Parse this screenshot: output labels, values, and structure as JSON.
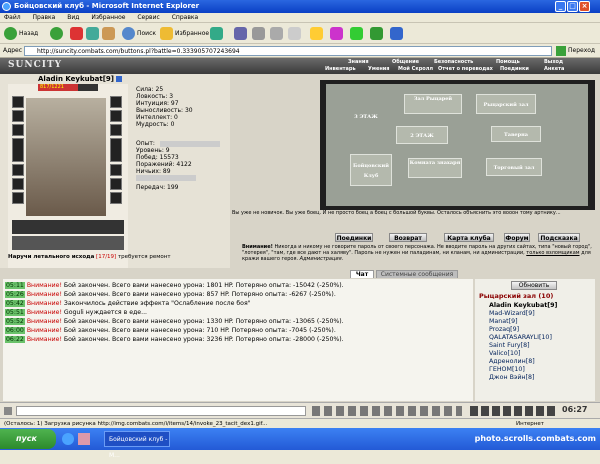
{
  "window": {
    "title": "Бойцовский клуб - Microsoft Internet Explorer"
  },
  "menu": [
    "Файл",
    "Правка",
    "Вид",
    "Избранное",
    "Сервис",
    "Справка"
  ],
  "toolbar": {
    "back": "Назад",
    "search": "Поиск",
    "favorites": "Избранное",
    "links": "Переход",
    "links2": "Ссылки"
  },
  "address": {
    "label": "Адрес",
    "url": "http://suncity.combats.com/buttons.pl?battle=0.333905707243694"
  },
  "game": {
    "logo": "SUNCITY",
    "nav_top": [
      "Знания",
      "Общение",
      "Безопасность",
      "Помощь",
      "Выход"
    ],
    "nav_bottom": [
      "Инвентарь",
      "Умения",
      "Мой Скролл",
      "Отчет о переводах",
      "Поединки",
      "Анкета"
    ],
    "character": {
      "name": "Aladin Keykubat",
      "level_tag": "[9]",
      "hp": "817/1221",
      "stats": [
        "Сила: 25",
        "Ловкость: 3",
        "Интуиция: 97",
        "Выносливость: 30",
        "Интеллект: 0",
        "Мудрость: 0"
      ],
      "experience": [
        "Опыт:",
        "Уровень: 9",
        "Побед: 15573",
        "Поражений: 4122",
        "Ничьих: 89",
        "",
        "Передач: 199"
      ],
      "item_note": "Наручи летального исхода",
      "item_durability": "[17/19]",
      "item_status": "требуется ремонт"
    },
    "map": {
      "floor": "3 ЭТАЖ",
      "rooms": [
        "Зал Рыцарей",
        "Рыцарский зал",
        "2 ЭТАЖ",
        "Таверна",
        "Бойцовский Клуб",
        "Комната знахаря",
        "Торговый зал"
      ]
    },
    "description": "Вы уже не новичок. Вы уже боец. И не просто боец а боец с большой буквы. Осталось объяснить это вооон тому артнику...",
    "buttons": [
      "Поединки",
      "Возврат",
      "Карта клуба",
      "Форум",
      "Подсказка"
    ],
    "warning": {
      "label": "Внимание!",
      "text": "Никогда и никому не говорите пароль от своего персонажа. Не вводите пароль на других сайтах, типа \"новый город\", \"лотерея\", \"там, где все дают на халяву\". Пароль не нужен ни паладинам, ни кланам, ни администрации,",
      "link": "только взломщикам",
      "tail": "для кражи вашего героя.",
      "admin": "Администрация."
    },
    "tabs": [
      "Чат",
      "Системные сообщения"
    ],
    "chat_messages": [
      {
        "time": "05:11",
        "warn": "Внимание!",
        "text": "Бой закончен. Всего вами нанесено урона: 1801 HP. Потеряно опыта: -15042 (-250%)."
      },
      {
        "time": "05:26",
        "warn": "Внимание!",
        "text": "Бой закончен. Всего вами нанесено урона: 857 HP. Потеряно опыта: -6267 (-250%)."
      },
      {
        "time": "05:42",
        "warn": "Внимание!",
        "text": "Закончилось действие эффекта \"Ослабление после боя\""
      },
      {
        "time": "05:51",
        "warn": "Внимание!",
        "text": "Goguli нуждается в еде..."
      },
      {
        "time": "05:52",
        "warn": "Внимание!",
        "text": "Бой закончен. Всего вами нанесено урона: 1330 HP. Потеряно опыта: -13065 (-250%)."
      },
      {
        "time": "06:00",
        "warn": "Внимание!",
        "text": "Бой закончен. Всего вами нанесено урона: 710 HP. Потеряно опыта: -7045 (-250%)."
      },
      {
        "time": "06:22",
        "warn": "Внимание!",
        "text": "Бой закончен. Всего вами нанесено урона: 3236 HP. Потеряно опыта: -28000 (-250%)."
      }
    ],
    "userlist": {
      "refresh": "Обновить",
      "room": "Рыцарский зал (10)",
      "users": [
        "Aladin Keykubat[9]",
        "Mad-Wizard[9]",
        "Manat[9]",
        "Prozaq[9]",
        "QALATASARAYLI[10]",
        "Saint Fury[8]",
        "Valico[10]",
        "Адренолин[8]",
        "ГЕНОМ[10]",
        "Джон Вэйн[8]"
      ]
    },
    "clock": "06:27"
  },
  "statusbar": {
    "text": "(Осталось: 1) Загрузка рисунка http://img.combats.com/i/items/14/invoke_23_tacit_dex1.gif...",
    "zone": "Интернет"
  },
  "taskbar": {
    "start": "пуск",
    "item": "Бойцовский клуб - M...",
    "watermark": "photo.scrolls.combats.com"
  },
  "colors": {
    "ie_blue": "#0a3fc4",
    "chat_time_green": "#6ac26a",
    "warning_red": "#c80000"
  }
}
